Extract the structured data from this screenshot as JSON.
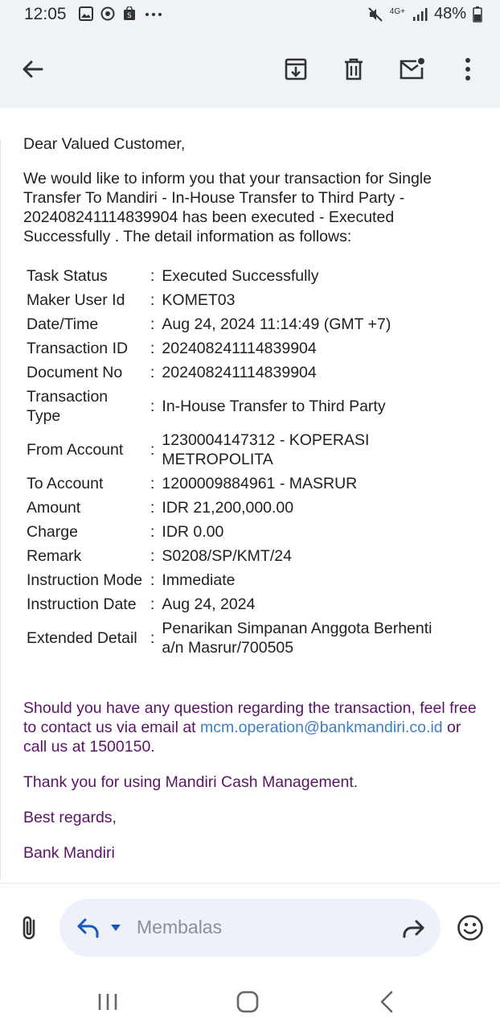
{
  "status_bar": {
    "time": "12:05",
    "left_icons": [
      "image-icon",
      "location-icon",
      "shopping-bag-icon",
      "more-dots-icon"
    ],
    "right_icons": [
      "mute-icon",
      "4g-icon",
      "signal-icon",
      "battery-icon"
    ],
    "network": "4G+",
    "battery": "48%"
  },
  "toolbar": {
    "icons": [
      "back-arrow-icon",
      "archive-icon",
      "delete-icon",
      "mark-unread-icon",
      "more-vert-icon"
    ]
  },
  "email": {
    "greeting": "Dear Valued Customer,",
    "intro": "We would like to inform you that your transaction for Single Transfer To Mandiri - In-House Transfer to Third Party - 202408241114839904 has been executed - Executed Successfully . The detail information as follows:",
    "details": [
      {
        "label": "Task Status",
        "value": "Executed Successfully"
      },
      {
        "label": "Maker User Id",
        "value": "KOMET03"
      },
      {
        "label": "Date/Time",
        "value": "Aug 24, 2024 11:14:49 (GMT +7)"
      },
      {
        "label": "Transaction ID",
        "value": "202408241114839904"
      },
      {
        "label": "Document No",
        "value": "202408241114839904"
      },
      {
        "label": "Transaction Type",
        "value": "In-House Transfer to Third Party"
      },
      {
        "label": "From Account",
        "value": "1230004147312 - KOPERASI METROPOLITA"
      },
      {
        "label": "To Account",
        "value": "1200009884961 - MASRUR"
      },
      {
        "label": "Amount",
        "value": "IDR 21,200,000.00"
      },
      {
        "label": "Charge",
        "value": "IDR 0.00"
      },
      {
        "label": "Remark",
        "value": "S0208/SP/KMT/24"
      },
      {
        "label": "Instruction Mode",
        "value": "Immediate"
      },
      {
        "label": "Instruction Date",
        "value": "Aug 24, 2024"
      },
      {
        "label": "Extended Detail",
        "value": "Penarikan Simpanan Anggota Berhenti a/n Masrur/700505"
      }
    ],
    "separator": ":",
    "question_text": "Should you have any question regarding the transaction, feel free to contact us via email at",
    "contact_email": "mcm.operation@bankmandiri.co.id",
    "call_text": "or call us at 1500150.",
    "thanks": "Thank you for using Mandiri Cash Management.",
    "regards": "Best regards,",
    "signature": "Bank Mandiri"
  },
  "reply": {
    "placeholder": "Membalas"
  },
  "colors": {
    "header_bg": "#eff3f8",
    "purple_text": "#5a1466",
    "link": "#3b7fc4",
    "reply_bar_bg": "#edf2fa"
  }
}
